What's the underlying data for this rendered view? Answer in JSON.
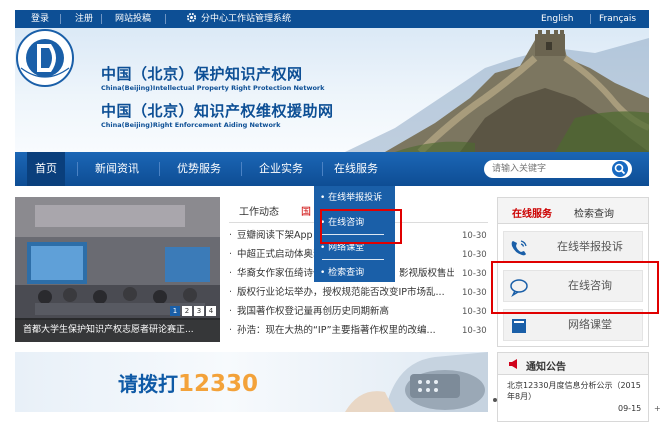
{
  "topbar": {
    "login": "登录",
    "register": "注册",
    "submit": "网站投稿",
    "admin": "分中心工作站管理系统",
    "english": "English",
    "french": "Français"
  },
  "banner": {
    "title1": "中国（北京）保护知识产权网",
    "subtitle1": "China(Beijing)Intellectual Property Right Protection Network",
    "title2": "中国（北京）知识产权维权援助网",
    "subtitle2": "China(Beijing)Right Enforcement Aiding Network"
  },
  "nav": {
    "items": [
      "首页",
      "新闻资讯",
      "优势服务",
      "企业实务",
      "在线服务"
    ],
    "search_placeholder": "请输入关键字"
  },
  "dropdown": {
    "items": [
      "在线举报投诉",
      "在线咨询",
      "网络课堂",
      "检索查询"
    ]
  },
  "photo": {
    "caption": "首都大学生保护知识产权志愿者研论赛正...",
    "pages": [
      "1",
      "2",
      "3",
      "4"
    ]
  },
  "news": {
    "tabs": [
      "工作动态",
      "国"
    ],
    "rows": [
      {
        "title": "豆瓣阅读下架App S",
        "date": "10-30"
      },
      {
        "title": "中超正式启动体奥动",
        "date": "10-30"
      },
      {
        "title": "华裔女作家伍绮诗作",
        "title_tail": "影视版权售出",
        "date": "10-30"
      },
      {
        "title": "版权行业论坛举办，授权规范能否改变IP市场乱...",
        "date": "10-30"
      },
      {
        "title": "我国著作权登记量再创历史同期新高",
        "date": "10-30"
      },
      {
        "title": "孙浩：现在大热的“IP”主要指著作权里的改编...",
        "date": "10-30"
      }
    ]
  },
  "right_panel": {
    "tabs": [
      "在线服务",
      "检索查询"
    ],
    "items": [
      "在线举报投诉",
      "在线咨询",
      "网络课堂"
    ]
  },
  "call_banner": {
    "text": "请拨打",
    "number": "12330"
  },
  "notice": {
    "title": "通知公告",
    "text": "北京12330月度信息分析公示（2015年8月）",
    "date": "09-15"
  },
  "colors": {
    "primary": "#0d4f95",
    "nav": "#1b66b6",
    "highlight": "#e00000",
    "accent": "#f3a23a"
  }
}
